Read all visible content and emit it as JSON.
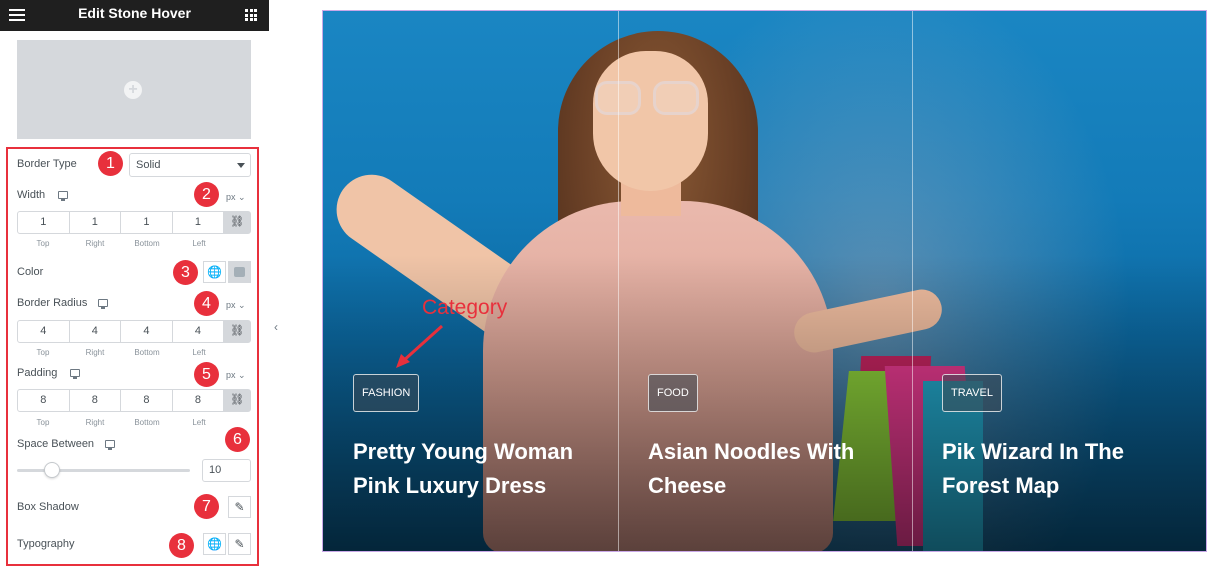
{
  "panel": {
    "title": "Edit Stone Hover",
    "border_type": {
      "label": "Border Type",
      "value": "Solid"
    },
    "width": {
      "label": "Width",
      "unit": "px",
      "values": [
        "1",
        "1",
        "1",
        "1"
      ],
      "sides": [
        "Top",
        "Right",
        "Bottom",
        "Left"
      ]
    },
    "color": {
      "label": "Color"
    },
    "border_radius": {
      "label": "Border Radius",
      "unit": "px",
      "values": [
        "4",
        "4",
        "4",
        "4"
      ],
      "sides": [
        "Top",
        "Right",
        "Bottom",
        "Left"
      ]
    },
    "padding": {
      "label": "Padding",
      "unit": "px",
      "values": [
        "8",
        "8",
        "8",
        "8"
      ],
      "sides": [
        "Top",
        "Right",
        "Bottom",
        "Left"
      ]
    },
    "space_between": {
      "label": "Space Between",
      "value": "10"
    },
    "box_shadow": {
      "label": "Box Shadow"
    },
    "typography": {
      "label": "Typography"
    },
    "markers": [
      "1",
      "2",
      "3",
      "4",
      "5",
      "6",
      "7",
      "8"
    ]
  },
  "preview": {
    "annotation": "Category",
    "cards": [
      {
        "category": "FASHION",
        "title_line1": "Pretty Young Woman",
        "title_line2": "Pink Luxury Dress"
      },
      {
        "category": "FOOD",
        "title_line1": "Asian Noodles With",
        "title_line2": "Cheese"
      },
      {
        "category": "TRAVEL",
        "title_line1": "Pik Wizard In The",
        "title_line2": "Forest Map"
      }
    ]
  },
  "icons": {
    "menu": "hamburger-icon",
    "apps": "grid-icon",
    "add": "plus-icon",
    "responsive": "desktop-icon",
    "link": "link-icon",
    "global": "globe-icon",
    "edit": "pencil-icon",
    "collapse": "chevron-left-icon"
  },
  "colors": {
    "accent": "#e8303c",
    "topbar": "#1f1f1f",
    "preview_bg": "#137bb8"
  }
}
